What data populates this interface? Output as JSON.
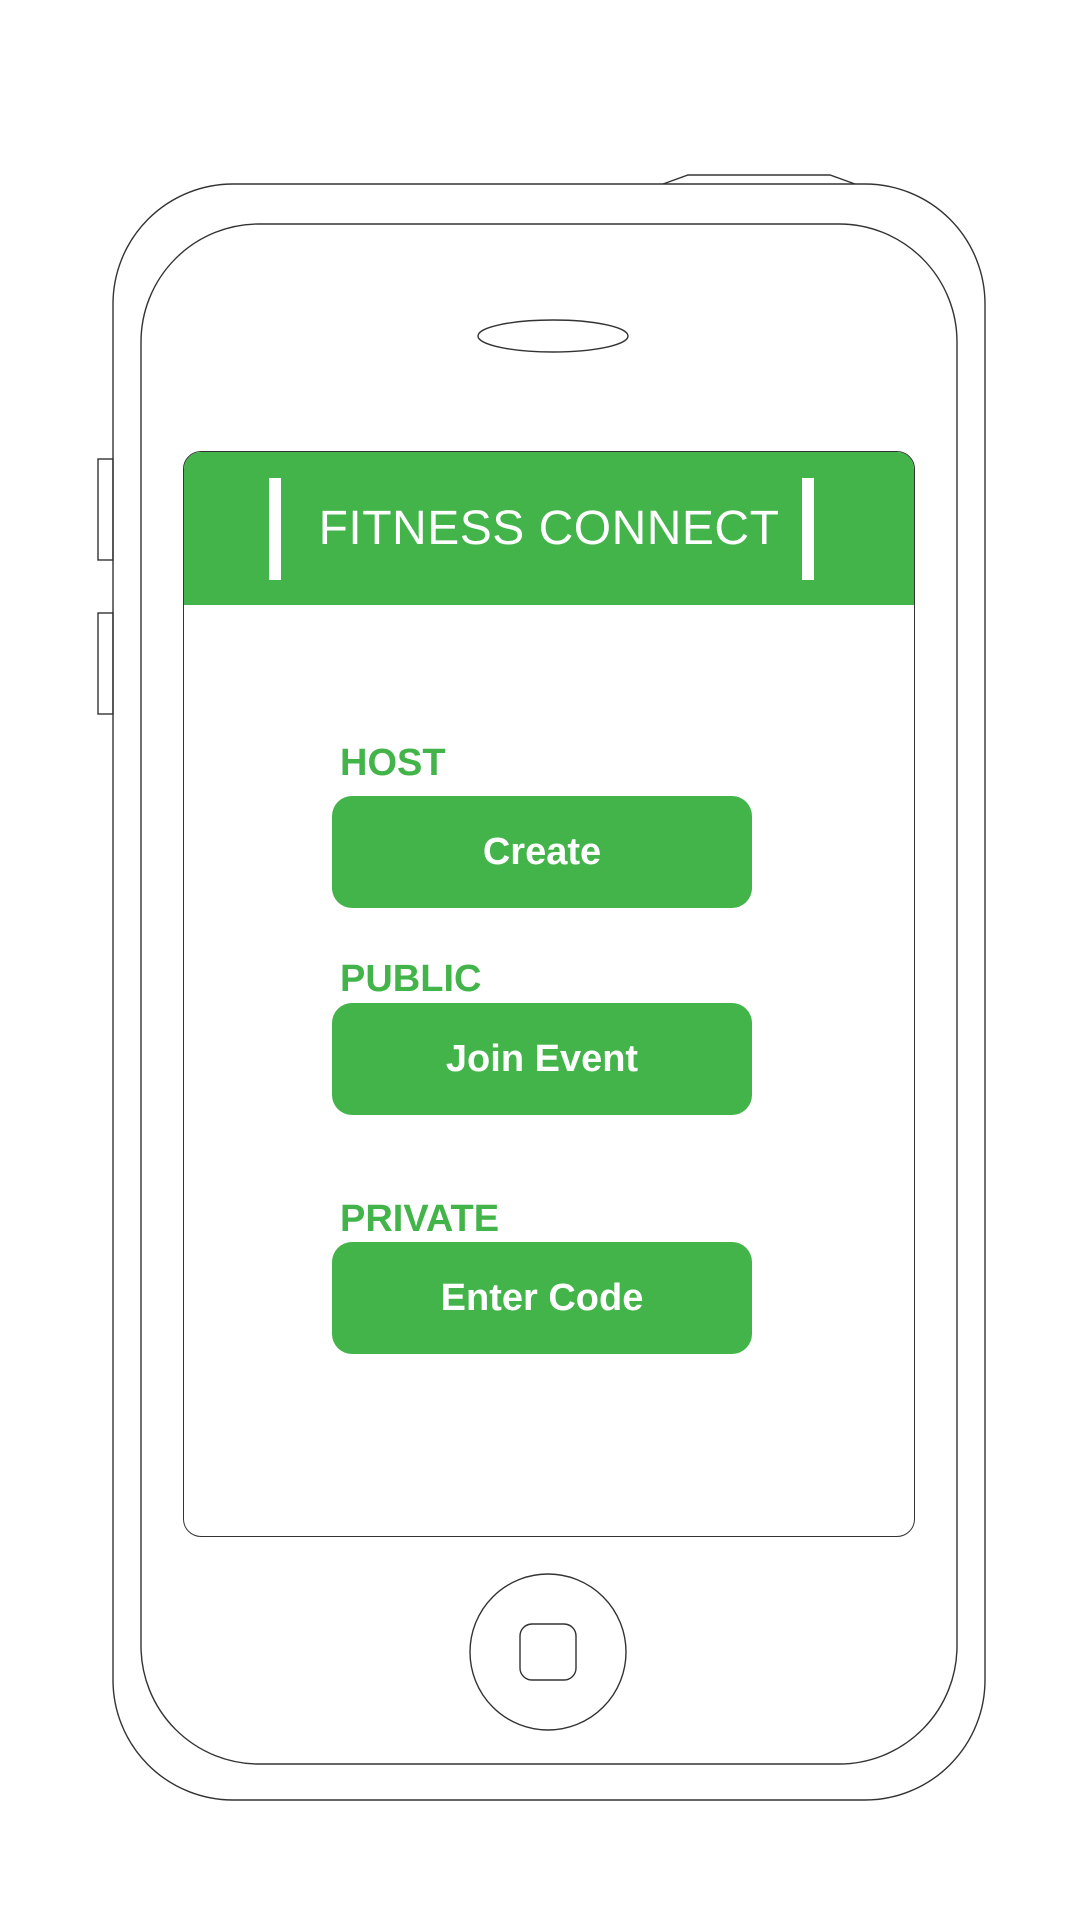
{
  "app": {
    "title": "FITNESS CONNECT",
    "accent_color": "#42b44a"
  },
  "sections": [
    {
      "label": "HOST",
      "button_label": "Create"
    },
    {
      "label": "PUBLIC",
      "button_label": "Join Event"
    },
    {
      "label": "PRIVATE",
      "button_label": "Enter Code"
    }
  ],
  "device": {
    "home_button_icon": "home-button-icon",
    "speaker_icon": "earpiece-speaker-icon"
  }
}
